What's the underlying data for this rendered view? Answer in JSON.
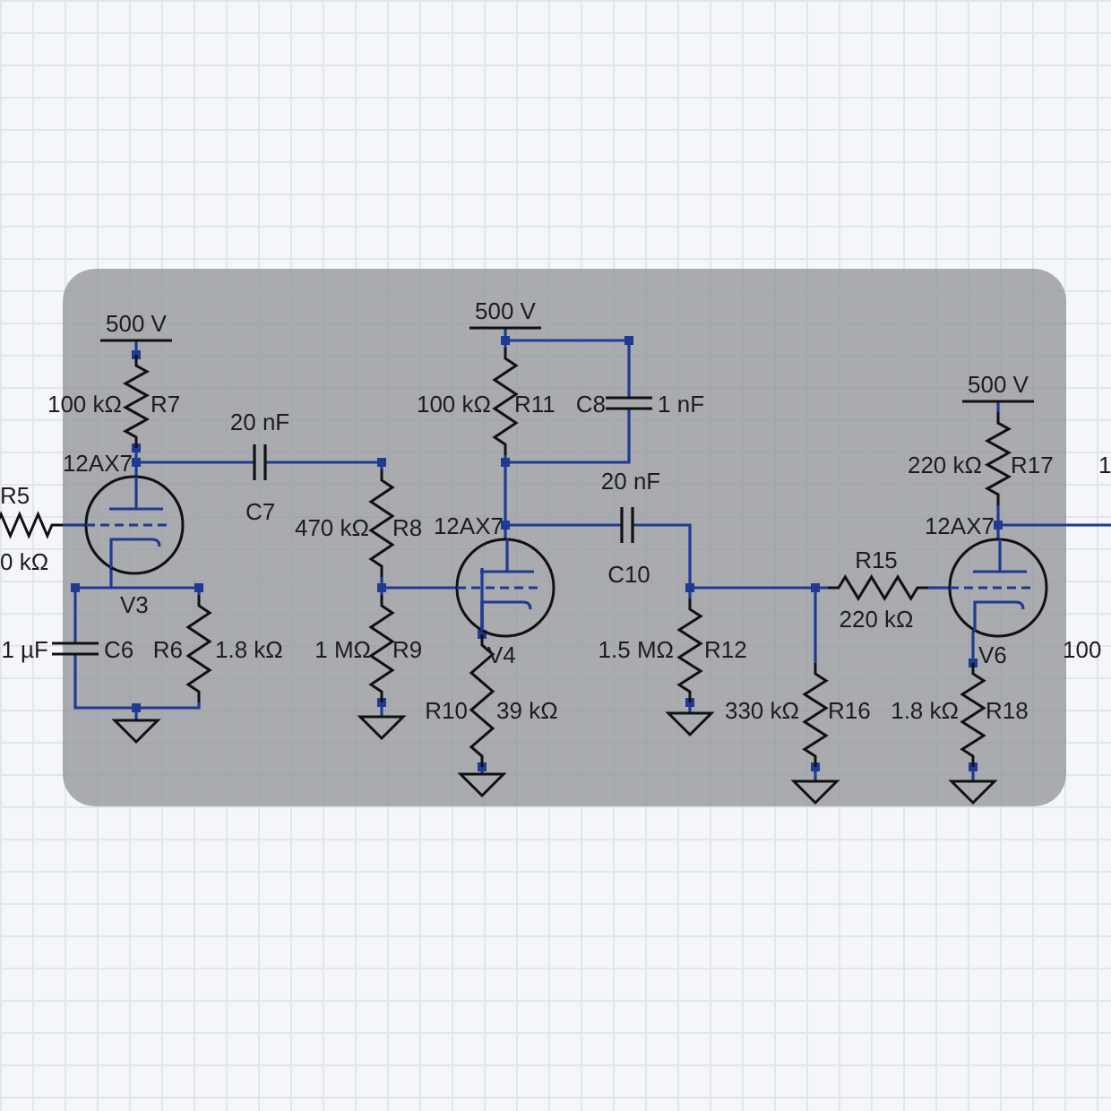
{
  "supplies": [
    {
      "label": "500 V"
    },
    {
      "label": "500 V"
    },
    {
      "label": "500 V"
    }
  ],
  "resistors": [
    {
      "ref": "R5",
      "value": "0 kΩ"
    },
    {
      "ref": "R7",
      "value": "100 kΩ"
    },
    {
      "ref": "R6",
      "value": "1.8 kΩ"
    },
    {
      "ref": "R8",
      "value": "470 kΩ"
    },
    {
      "ref": "R9",
      "value": "1 MΩ"
    },
    {
      "ref": "R11",
      "value": "100 kΩ"
    },
    {
      "ref": "R10",
      "value": "39 kΩ"
    },
    {
      "ref": "R12",
      "value": "1.5 MΩ"
    },
    {
      "ref": "R15",
      "value": "220 kΩ"
    },
    {
      "ref": "R16",
      "value": "330 kΩ"
    },
    {
      "ref": "R17",
      "value": "220 kΩ"
    },
    {
      "ref": "R18",
      "value": "1.8 kΩ"
    }
  ],
  "capacitors": [
    {
      "ref": "C7",
      "value": "20 nF"
    },
    {
      "ref": "C6",
      "value": "1 µF"
    },
    {
      "ref": "C8",
      "value": "1 nF"
    },
    {
      "ref": "C10",
      "value": "20 nF"
    }
  ],
  "tubes": [
    {
      "type": "12AX7",
      "ref": "V3"
    },
    {
      "type": "12AX7",
      "ref": "V4"
    },
    {
      "type": "12AX7",
      "ref": "V6"
    }
  ],
  "edge_texts": [
    "100",
    "1"
  ]
}
